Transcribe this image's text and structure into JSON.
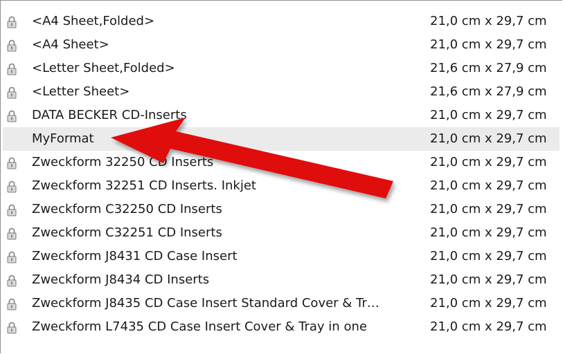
{
  "formats": [
    {
      "name": "<A4 Sheet,Folded>",
      "size": "21,0 cm x 29,7 cm",
      "locked": true
    },
    {
      "name": "<A4 Sheet>",
      "size": "21,0 cm x 29,7 cm",
      "locked": true
    },
    {
      "name": "<Letter Sheet,Folded>",
      "size": "21,6 cm x 27,9 cm",
      "locked": true
    },
    {
      "name": "<Letter Sheet>",
      "size": "21,6 cm x 27,9 cm",
      "locked": true
    },
    {
      "name": "DATA BECKER CD-Inserts",
      "size": "21,0 cm x 29,7 cm",
      "locked": true
    },
    {
      "name": "MyFormat",
      "size": "21,0 cm x 29,7 cm",
      "locked": false,
      "selected": true
    },
    {
      "name": "Zweckform 32250 CD Inserts",
      "size": "21,0 cm x 29,7 cm",
      "locked": true
    },
    {
      "name": "Zweckform 32251 CD Inserts. Inkjet",
      "size": "21,0 cm x 29,7 cm",
      "locked": true
    },
    {
      "name": "Zweckform C32250 CD Inserts",
      "size": "21,0 cm x 29,7 cm",
      "locked": true
    },
    {
      "name": "Zweckform C32251 CD Inserts",
      "size": "21,0 cm x 29,7 cm",
      "locked": true
    },
    {
      "name": "Zweckform J8431 CD Case Insert",
      "size": "21,0 cm x 29,7 cm",
      "locked": true
    },
    {
      "name": "Zweckform J8434 CD Inserts",
      "size": "21,0 cm x 29,7 cm",
      "locked": true
    },
    {
      "name": "Zweckform J8435 CD Case Insert Standard Cover & Tr…",
      "size": "21,0 cm x 29,7 cm",
      "locked": true
    },
    {
      "name": "Zweckform L7435 CD Case Insert Cover & Tray in one",
      "size": "21,0 cm x 29,7 cm",
      "locked": true
    }
  ],
  "icons": {
    "lock": "lock-icon",
    "annotation": "red-arrow-pointer"
  },
  "colors": {
    "arrow": "#e01010",
    "selected_row": "#ebebeb"
  }
}
